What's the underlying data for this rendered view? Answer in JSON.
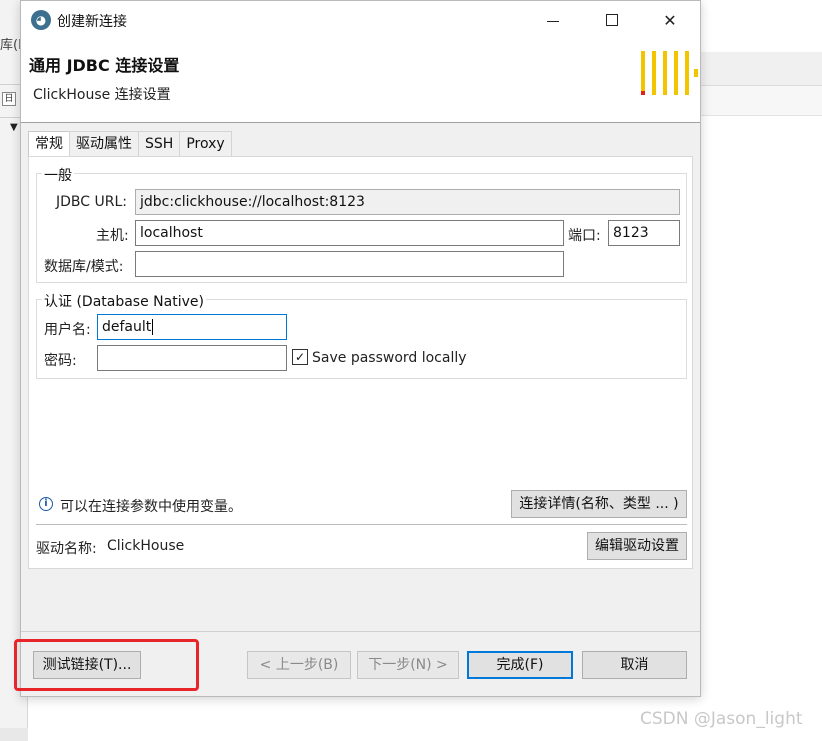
{
  "background": {
    "left_label": "库(D",
    "left_button_glyph": "日",
    "left_arrow_glyph": "▼"
  },
  "titlebar": {
    "title": "创建新连接",
    "icon_glyph": "◕",
    "close_glyph": "✕"
  },
  "header": {
    "title": "通用 JDBC 连接设置",
    "subtitle": "ClickHouse 连接设置",
    "logo_colors": [
      "#f2c500",
      "#e2231a"
    ]
  },
  "tabs": [
    {
      "label": "常规",
      "active": true
    },
    {
      "label": "驱动属性",
      "active": false
    },
    {
      "label": "SSH",
      "active": false
    },
    {
      "label": "Proxy",
      "active": false
    }
  ],
  "general": {
    "legend": "一般",
    "jdbc_url_label": "JDBC URL:",
    "jdbc_url_value": "jdbc:clickhouse://localhost:8123",
    "host_label": "主机:",
    "host_value": "localhost",
    "port_label": "端口:",
    "port_value": "8123",
    "database_label": "数据库/模式:",
    "database_value": ""
  },
  "auth": {
    "legend": "认证 (Database Native)",
    "username_label": "用户名:",
    "username_value": "default",
    "password_label": "密码:",
    "password_value": "",
    "save_password_label": "Save password locally",
    "save_password_checked": true,
    "check_glyph": "✓"
  },
  "info": {
    "icon_glyph": "i",
    "text": "可以在连接参数中使用变量。",
    "details_button": "连接详情(名称、类型 ... )"
  },
  "driver": {
    "label": "驱动名称:",
    "name": "ClickHouse",
    "edit_button": "编辑驱动设置"
  },
  "footer": {
    "test_button": "测试链接(T)...",
    "back_button": "< 上一步(B)",
    "next_button": "下一步(N) >",
    "finish_button": "完成(F)",
    "cancel_button": "取消"
  },
  "colors": {
    "highlight_box": "#e8262a",
    "focus_border": "#0078d7"
  },
  "watermark": "CSDN @Jason_light"
}
